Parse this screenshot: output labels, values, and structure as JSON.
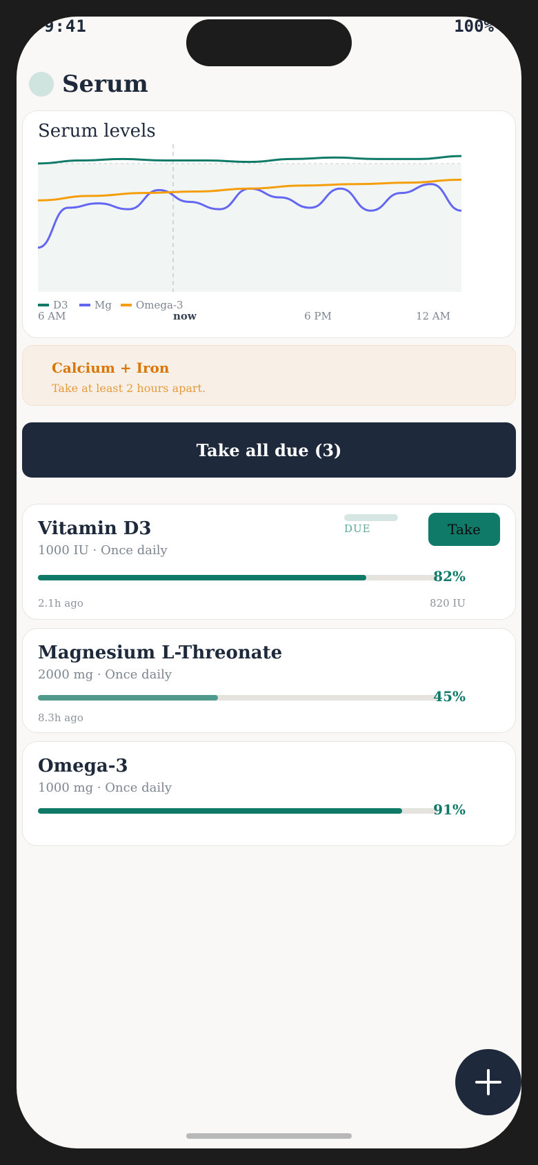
{
  "status": {
    "time": "9:41",
    "battery": "100%"
  },
  "header": {
    "title": "Serum"
  },
  "chart": {
    "title": "Serum levels",
    "legend": [
      "D3",
      "Mg",
      "Omega-3"
    ],
    "x_labels": [
      "6 AM",
      "now",
      "6 PM",
      "12 AM"
    ]
  },
  "chart_data": {
    "type": "line",
    "title": "Serum levels",
    "x": [
      "6 AM",
      "now",
      "6 PM",
      "12 AM"
    ],
    "series": [
      {
        "name": "D3",
        "color": "#0f7a68",
        "values": [
          0.87,
          0.89,
          0.9,
          0.89,
          0.89,
          0.88,
          0.9,
          0.91,
          0.9,
          0.9,
          0.92
        ]
      },
      {
        "name": "Mg",
        "color": "#6366f1",
        "values": [
          0.3,
          0.57,
          0.6,
          0.56,
          0.69,
          0.61,
          0.56,
          0.7,
          0.64,
          0.57,
          0.7,
          0.55,
          0.67,
          0.73,
          0.55
        ]
      },
      {
        "name": "Omega-3",
        "color": "#f59e0b",
        "values": [
          0.62,
          0.65,
          0.67,
          0.68,
          0.7,
          0.72,
          0.73,
          0.74,
          0.76
        ]
      }
    ],
    "ylim": [
      0,
      1
    ],
    "legend_position": "bottom-left"
  },
  "interaction": {
    "title": "Calcium + Iron",
    "text": "Take at least 2 hours apart."
  },
  "take_all": {
    "label": "Take all due (3)"
  },
  "supplements": [
    {
      "name": "Vitamin D3",
      "dose": "1000 IU · Once daily",
      "percent_label": "82%",
      "level": 0.82,
      "ago": "2.1h ago",
      "amount": "820 IU",
      "due_label": "DUE",
      "take_label": "Take",
      "color": "#0f7a68"
    },
    {
      "name": "Magnesium L-Threonate",
      "dose": "2000 mg · Once daily",
      "percent_label": "45%",
      "level": 0.45,
      "ago": "8.3h ago",
      "color": "#4f9a8c"
    },
    {
      "name": "Omega-3",
      "dose": "1000 mg · Once daily",
      "percent_label": "91%",
      "level": 0.91,
      "color": "#0f7a68"
    }
  ],
  "fab": {
    "icon": "plus-icon"
  }
}
